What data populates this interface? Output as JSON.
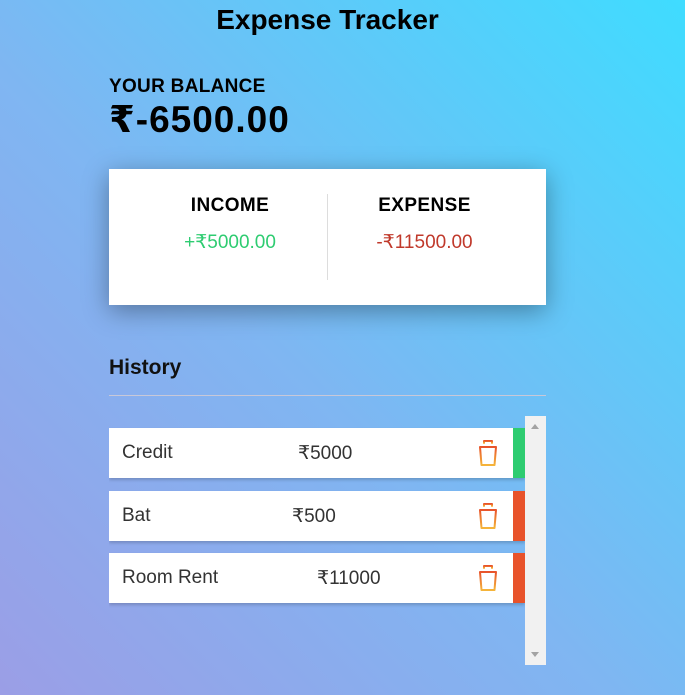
{
  "app": {
    "title": "Expense Tracker"
  },
  "balance": {
    "label": "YOUR BALANCE",
    "value": "₹-6500.00"
  },
  "summary": {
    "income_label": "INCOME",
    "income_value": "+₹5000.00",
    "expense_label": "EXPENSE",
    "expense_value": "-₹11500.00"
  },
  "history": {
    "title": "History",
    "items": [
      {
        "name": "Credit",
        "amount": "₹5000",
        "type": "income"
      },
      {
        "name": "Bat",
        "amount": "₹500",
        "type": "expense"
      },
      {
        "name": "Room Rent",
        "amount": "₹11000",
        "type": "expense"
      }
    ]
  },
  "colors": {
    "income": "#2ecc71",
    "expense_text": "#c0392b",
    "expense_stripe": "#e8532b",
    "trash_top": "#e8532b",
    "trash_bottom": "#f5b43a"
  },
  "icons": {
    "delete": "trash-icon",
    "scroll_up": "arrow-up-icon",
    "scroll_down": "arrow-down-icon"
  }
}
